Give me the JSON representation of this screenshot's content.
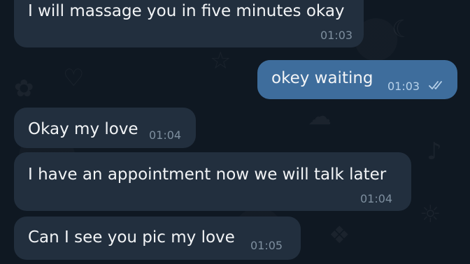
{
  "messages": [
    {
      "direction": "incoming",
      "text": "I will massage you in five minutes okay",
      "time": "01:03"
    },
    {
      "direction": "outgoing",
      "text": "okey waiting",
      "time": "01:03",
      "status": "read"
    },
    {
      "direction": "incoming",
      "text": "Okay my love",
      "time": "01:04"
    },
    {
      "direction": "incoming",
      "text": "I have an appointment now we will talk later",
      "time": "01:04"
    },
    {
      "direction": "incoming",
      "text": "Can I see you pic my love",
      "time": "01:05"
    }
  ],
  "colors": {
    "background": "#0f1822",
    "incoming_bubble": "#222f3e",
    "outgoing_bubble": "#3e6d9c",
    "text": "#f2f4f6"
  },
  "icons": {
    "read_receipt": "double-check-icon"
  }
}
